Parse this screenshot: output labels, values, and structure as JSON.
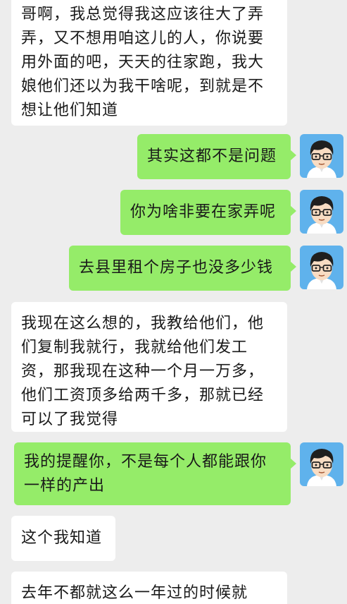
{
  "messages": [
    {
      "side": "left",
      "text": "哥啊，我总觉得我这应该往大了弄弄，又不想用咱这儿的人，你说要用外面的吧，天天的往家跑，我大娘他们还以为我干啥呢，到就是不想让他们知道"
    },
    {
      "side": "right",
      "text": "其实这都不是问题"
    },
    {
      "side": "right",
      "text": "你为啥非要在家弄呢"
    },
    {
      "side": "right",
      "text": "去县里租个房子也没多少钱"
    },
    {
      "side": "left",
      "text": "我现在这么想的，我教给他们，他们复制我就行，我就给他们发工资，那我现在这种一个月一万多，他们工资顶多给两千多，那就已经可以了我觉得"
    },
    {
      "side": "right",
      "text": "我的提醒你，不是每个人都能跟你一样的产出"
    },
    {
      "side": "left",
      "text": "这个我知道"
    },
    {
      "side": "left",
      "text": "去年不都就这么一年过的时候就"
    }
  ],
  "avatar": {
    "icon": "boy-with-glasses-icon",
    "bg": "#5fb2ec"
  },
  "colors": {
    "outgoing": "#95ec69",
    "incoming": "#ffffff",
    "background": "#ededed"
  }
}
